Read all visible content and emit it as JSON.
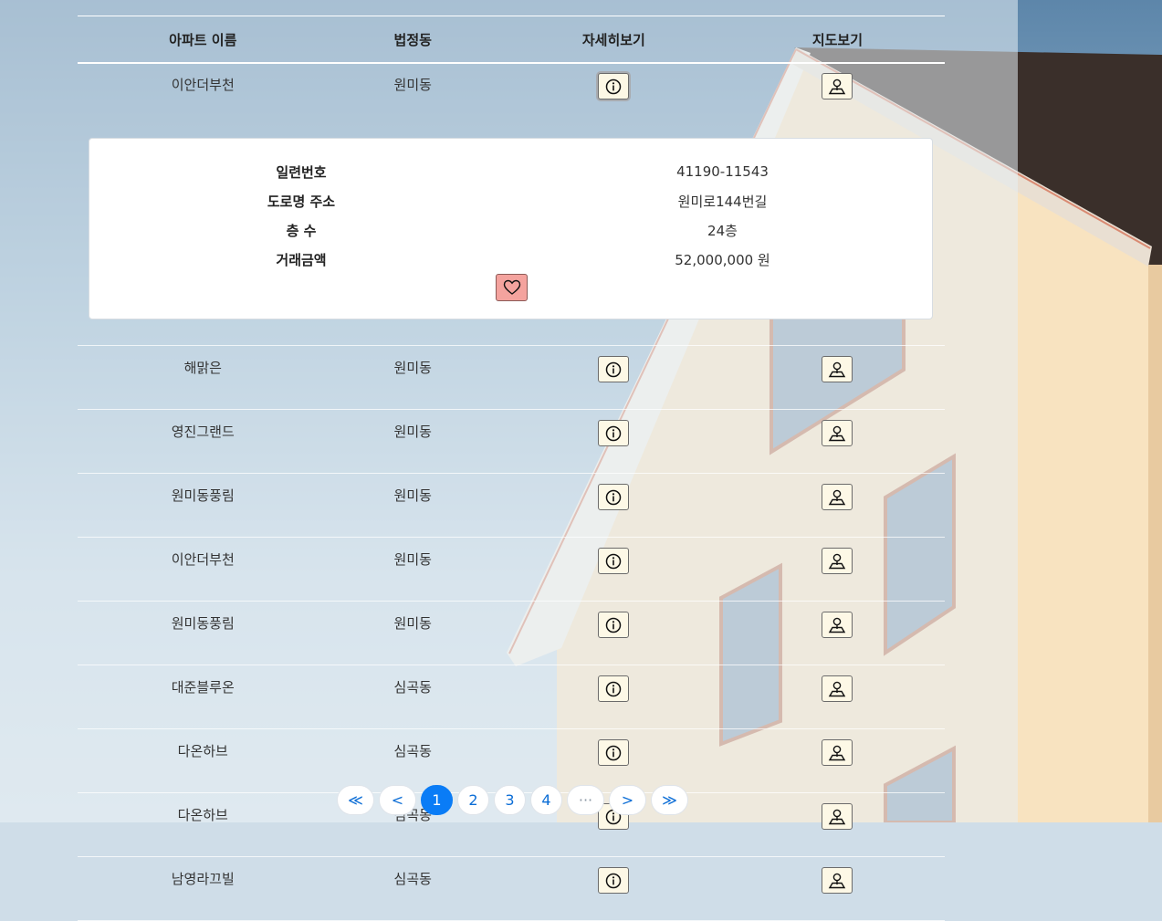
{
  "table": {
    "headers": [
      "아파트 이름",
      "법정동",
      "자세히보기",
      "지도보기"
    ],
    "first_row": {
      "name": "이안더부천",
      "dong": "원미동"
    },
    "rows": [
      {
        "name": "해맑은",
        "dong": "원미동"
      },
      {
        "name": "영진그랜드",
        "dong": "원미동"
      },
      {
        "name": "원미동풍림",
        "dong": "원미동"
      },
      {
        "name": "이안더부천",
        "dong": "원미동"
      },
      {
        "name": "원미동풍림",
        "dong": "원미동"
      },
      {
        "name": "대준블루온",
        "dong": "심곡동"
      },
      {
        "name": "다온하브",
        "dong": "심곡동"
      },
      {
        "name": "다온하브",
        "dong": "심곡동"
      },
      {
        "name": "남영라끄빌",
        "dong": "심곡동"
      }
    ]
  },
  "detail": {
    "items": [
      {
        "label": "일련번호",
        "value": "41190-11543"
      },
      {
        "label": "도로명 주소",
        "value": "원미로144번길"
      },
      {
        "label": "층 수",
        "value": "24층"
      },
      {
        "label": "거래금액",
        "value": "52,000,000 원"
      }
    ]
  },
  "pagination": {
    "first": "≪",
    "prev": "<",
    "pages": [
      "1",
      "2",
      "3",
      "4"
    ],
    "ellipsis": "···",
    "next": ">",
    "last": "≫",
    "current": "1"
  },
  "icons": {
    "info": "info-circle-icon",
    "map": "map-pin-person-icon",
    "favorite": "heart-icon"
  },
  "colors": {
    "accent": "#0a7cf6",
    "favorite_button": "#f4a39e",
    "icon_button": "#fdf8e6"
  }
}
